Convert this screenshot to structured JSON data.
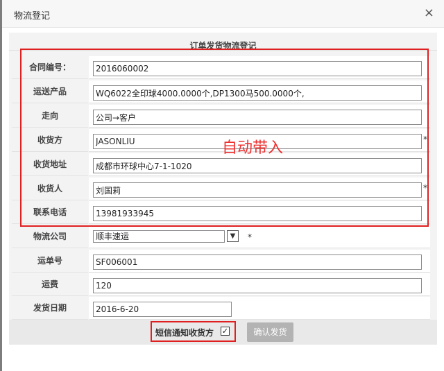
{
  "dialog": {
    "title": "物流登记",
    "close_icon": "close-icon",
    "close_glyph": "×",
    "header": "订单发货物流登记"
  },
  "form": {
    "contract_no": {
      "label": "合同编号：",
      "value": "2016060002"
    },
    "product": {
      "label": "运送产品",
      "value": "WQ6022全印球4000.0000个,DP1300马500.0000个,"
    },
    "direction": {
      "label": "走向",
      "value": "公司→客户"
    },
    "receiver_party": {
      "label": "收货方",
      "value": "JASONLIU",
      "required": "*"
    },
    "address": {
      "label": "收货地址",
      "value": "成都市环球中心7-1-1020"
    },
    "receiver": {
      "label": "收货人",
      "value": "刘国莉",
      "required": "*"
    },
    "phone": {
      "label": "联系电话",
      "value": "13981933945"
    },
    "logistics_company": {
      "label": "物流公司",
      "value": "顺丰速运",
      "required": "*"
    },
    "waybill_no": {
      "label": "运单号",
      "value": "SF006001"
    },
    "freight": {
      "label": "运费",
      "value": "120"
    },
    "ship_date": {
      "label": "发货日期",
      "value": "2016-6-20"
    }
  },
  "annotation": {
    "text": "自动带入",
    "color": "#ee3030"
  },
  "footer": {
    "sms_label": "短信通知收货方",
    "sms_checked": "✓",
    "confirm_label": "确认发货"
  }
}
